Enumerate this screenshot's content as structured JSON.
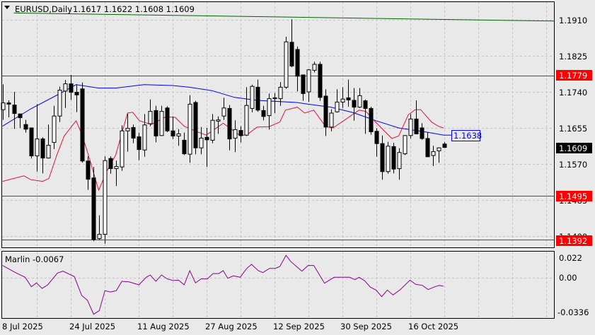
{
  "header": {
    "symbol_timeframe": "EURUSD,Daily",
    "ohlc_text": "1.1617 1.1622 1.1608 1.1609"
  },
  "indicator": {
    "label": "Marlin -0.0067",
    "axis_labels": [
      "0.022",
      "0.00",
      "-0.0336"
    ]
  },
  "price_axis": {
    "ticks": [
      "1.1910",
      "1.1825",
      "1.1740",
      "1.1655",
      "1.1570",
      "1.1485",
      "1.1400"
    ],
    "levels": [
      {
        "label": "1.1779",
        "value": 1.1779
      },
      {
        "label": "1.1495",
        "value": 1.1495
      },
      {
        "label": "1.1392",
        "value": 1.1392
      }
    ],
    "current_price_label": "1.1609",
    "ma_label": "1.1638"
  },
  "time_axis": {
    "labels": [
      "8 Jul 2025",
      "24 Jul 2025",
      "11 Aug 2025",
      "27 Aug 2025",
      "12 Sep 2025",
      "30 Sep 2025",
      "16 Oct 2025"
    ]
  },
  "colors": {
    "background": "#e9e9e9",
    "grid": "#c4c4c4",
    "level_line": "#ff0000",
    "level_label_bg": "#ff0000",
    "ma_blue": "#0000ff",
    "ma_red": "#e0143c",
    "trend_green": "#006400",
    "marlin": "#8b008b",
    "bull_body": "#ffffff",
    "bear_body": "#000000"
  },
  "chart_data": {
    "type": "candlestick",
    "title": "EURUSD,Daily",
    "ylim": [
      1.1365,
      1.196
    ],
    "price_grid": [
      1.191,
      1.1825,
      1.174,
      1.1655,
      1.157,
      1.1485,
      1.14
    ],
    "x_label_every_bars": 12,
    "ohlc": [
      [
        1.1698,
        1.1758,
        1.1674,
        1.1714
      ],
      [
        1.1714,
        1.172,
        1.168,
        1.1711
      ],
      [
        1.1709,
        1.174,
        1.1653,
        1.1689
      ],
      [
        1.1688,
        1.1688,
        1.1655,
        1.1679
      ],
      [
        1.1663,
        1.1674,
        1.1644,
        1.1652
      ],
      [
        1.1655,
        1.1655,
        1.1583,
        1.1589
      ],
      [
        1.1589,
        1.1711,
        1.1552,
        1.1629
      ],
      [
        1.1629,
        1.1633,
        1.1548,
        1.1584
      ],
      [
        1.1584,
        1.1663,
        1.1583,
        1.1614
      ],
      [
        1.1621,
        1.1707,
        1.1605,
        1.1683
      ],
      [
        1.1683,
        1.1752,
        1.1669,
        1.1744
      ],
      [
        1.1742,
        1.1768,
        1.1702,
        1.1759
      ],
      [
        1.1759,
        1.178,
        1.1721,
        1.1739
      ],
      [
        1.1739,
        1.1758,
        1.1692,
        1.1733
      ],
      [
        1.1747,
        1.1762,
        1.1573,
        1.1577
      ],
      [
        1.1577,
        1.1588,
        1.1509,
        1.1534
      ],
      [
        1.1537,
        1.1563,
        1.1388,
        1.1392
      ],
      [
        1.1394,
        1.1449,
        1.1391,
        1.1404
      ],
      [
        1.1404,
        1.1588,
        1.1382,
        1.1578
      ],
      [
        1.1583,
        1.1588,
        1.1547,
        1.1559
      ],
      [
        1.1559,
        1.1578,
        1.1518,
        1.1564
      ],
      [
        1.1563,
        1.1661,
        1.1554,
        1.1648
      ],
      [
        1.1648,
        1.1688,
        1.1599,
        1.1654
      ],
      [
        1.1656,
        1.1663,
        1.1619,
        1.1631
      ],
      [
        1.1634,
        1.1644,
        1.1579,
        1.1604
      ],
      [
        1.1603,
        1.1688,
        1.1587,
        1.1662
      ],
      [
        1.1665,
        1.1722,
        1.1659,
        1.1694
      ],
      [
        1.1696,
        1.1707,
        1.1621,
        1.1636
      ],
      [
        1.1637,
        1.1707,
        1.1636,
        1.1694
      ],
      [
        1.1702,
        1.1706,
        1.1645,
        1.1648
      ],
      [
        1.1648,
        1.1682,
        1.1629,
        1.1636
      ],
      [
        1.1636,
        1.1652,
        1.1613,
        1.1641
      ],
      [
        1.1626,
        1.1644,
        1.1591,
        1.1594
      ],
      [
        1.1593,
        1.1732,
        1.1573,
        1.1711
      ],
      [
        1.1715,
        1.1719,
        1.1593,
        1.1608
      ],
      [
        1.1608,
        1.1657,
        1.1593,
        1.1631
      ],
      [
        1.1633,
        1.1655,
        1.1563,
        1.1627
      ],
      [
        1.1626,
        1.1688,
        1.1619,
        1.1673
      ],
      [
        1.1671,
        1.1682,
        1.1641,
        1.1674
      ],
      [
        1.1683,
        1.1726,
        1.1674,
        1.1702
      ],
      [
        1.1701,
        1.1709,
        1.1602,
        1.1629
      ],
      [
        1.1631,
        1.1673,
        1.1598,
        1.1651
      ],
      [
        1.1649,
        1.1659,
        1.1621,
        1.1637
      ],
      [
        1.1638,
        1.1751,
        1.1636,
        1.1708
      ],
      [
        1.1701,
        1.1757,
        1.1692,
        1.1753
      ],
      [
        1.1751,
        1.1769,
        1.1693,
        1.1697
      ],
      [
        1.1696,
        1.1707,
        1.1673,
        1.1682
      ],
      [
        1.1684,
        1.1736,
        1.1651,
        1.1724
      ],
      [
        1.1724,
        1.1737,
        1.169,
        1.1726
      ],
      [
        1.1724,
        1.1763,
        1.1707,
        1.1751
      ],
      [
        1.1751,
        1.187,
        1.1747,
        1.1858
      ],
      [
        1.1857,
        1.1911,
        1.1798,
        1.1801
      ],
      [
        1.184,
        1.1847,
        1.1741,
        1.1777
      ],
      [
        1.178,
        1.178,
        1.1719,
        1.1736
      ],
      [
        1.174,
        1.1794,
        1.1716,
        1.1792
      ],
      [
        1.1791,
        1.1811,
        1.1786,
        1.1805
      ],
      [
        1.1805,
        1.1811,
        1.1719,
        1.1727
      ],
      [
        1.173,
        1.1746,
        1.1636,
        1.1657
      ],
      [
        1.1657,
        1.1699,
        1.1647,
        1.169
      ],
      [
        1.1693,
        1.1746,
        1.1691,
        1.1716
      ],
      [
        1.1716,
        1.1751,
        1.1702,
        1.1723
      ],
      [
        1.1726,
        1.1769,
        1.1705,
        1.1721
      ],
      [
        1.172,
        1.1749,
        1.1672,
        1.1704
      ],
      [
        1.1704,
        1.1749,
        1.1702,
        1.1731
      ],
      [
        1.1719,
        1.1722,
        1.1641,
        1.1701
      ],
      [
        1.1701,
        1.1705,
        1.1639,
        1.1646
      ],
      [
        1.1647,
        1.1654,
        1.1587,
        1.1618
      ],
      [
        1.1618,
        1.1637,
        1.1533,
        1.1552
      ],
      [
        1.1552,
        1.1622,
        1.1547,
        1.1612
      ],
      [
        1.1611,
        1.162,
        1.1548,
        1.1558
      ],
      [
        1.1559,
        1.1607,
        1.1533,
        1.1597
      ],
      [
        1.1594,
        1.1638,
        1.1591,
        1.1637
      ],
      [
        1.1637,
        1.1688,
        1.163,
        1.1676
      ],
      [
        1.1676,
        1.172,
        1.164,
        1.1641
      ],
      [
        1.1655,
        1.1666,
        1.1627,
        1.163
      ],
      [
        1.163,
        1.1645,
        1.1587,
        1.1587
      ],
      [
        1.159,
        1.1613,
        1.1565,
        1.1599
      ],
      [
        1.1601,
        1.1609,
        1.1573,
        1.1608
      ],
      [
        1.1617,
        1.1622,
        1.1608,
        1.1609
      ]
    ],
    "ma_blue": [
      [
        0,
        1.1659
      ],
      [
        5,
        1.17
      ],
      [
        10,
        1.1735
      ],
      [
        13,
        1.1757
      ],
      [
        17,
        1.1749
      ],
      [
        20,
        1.1749
      ],
      [
        25,
        1.1757
      ],
      [
        30,
        1.1755
      ],
      [
        33,
        1.1751
      ],
      [
        37,
        1.1743
      ],
      [
        41,
        1.1727
      ],
      [
        45,
        1.172
      ],
      [
        52,
        1.1715
      ],
      [
        54,
        1.1711
      ],
      [
        58,
        1.1704
      ],
      [
        62,
        1.1691
      ],
      [
        66,
        1.1672
      ],
      [
        70,
        1.1655
      ],
      [
        75,
        1.1645
      ],
      [
        78,
        1.1638
      ]
    ],
    "ma_red": [
      [
        0,
        1.1529
      ],
      [
        3.8,
        1.1542
      ],
      [
        5,
        1.1533
      ],
      [
        7.1,
        1.1529
      ],
      [
        8.2,
        1.1536
      ],
      [
        9.6,
        1.1591
      ],
      [
        10.9,
        1.1636
      ],
      [
        13,
        1.1672
      ],
      [
        14,
        1.1641
      ],
      [
        15,
        1.1599
      ],
      [
        17,
        1.1508
      ],
      [
        18.4,
        1.1552
      ],
      [
        20,
        1.1591
      ],
      [
        22.1,
        1.169
      ],
      [
        23,
        1.1692
      ],
      [
        24.2,
        1.1672
      ],
      [
        26.3,
        1.1663
      ],
      [
        28.8,
        1.1681
      ],
      [
        30.5,
        1.168
      ],
      [
        32.1,
        1.1659
      ],
      [
        34.2,
        1.1647
      ],
      [
        36,
        1.1638
      ],
      [
        39,
        1.1666
      ],
      [
        42.1,
        1.1636
      ],
      [
        43.4,
        1.1641
      ],
      [
        45,
        1.1657
      ],
      [
        47.1,
        1.1658
      ],
      [
        49,
        1.1669
      ],
      [
        50,
        1.1697
      ],
      [
        52.1,
        1.1704
      ],
      [
        53.4,
        1.169
      ],
      [
        55,
        1.1697
      ],
      [
        57.1,
        1.1658
      ],
      [
        58.4,
        1.1655
      ],
      [
        60.5,
        1.1674
      ],
      [
        63,
        1.1697
      ],
      [
        64.2,
        1.1694
      ],
      [
        65.9,
        1.1669
      ],
      [
        68.8,
        1.163
      ],
      [
        70,
        1.1636
      ],
      [
        71.7,
        1.1686
      ],
      [
        72.9,
        1.1698
      ],
      [
        73.9,
        1.1698
      ],
      [
        75.8,
        1.1669
      ],
      [
        77,
        1.1659
      ],
      [
        77.9,
        1.1655
      ]
    ],
    "trend_green": [
      [
        2,
        1.1926
      ],
      [
        97.5,
        1.1907
      ]
    ],
    "marlin": {
      "name": "Marlin",
      "last": -0.0067,
      "ylim": [
        -0.0336,
        0.022
      ],
      "points": [
        [
          0,
          0.0097
        ],
        [
          2.3,
          0.0041
        ],
        [
          4,
          0.0004
        ],
        [
          5.1,
          -0.0071
        ],
        [
          6,
          -0.0041
        ],
        [
          7,
          -0.0084
        ],
        [
          8,
          -0.0056
        ],
        [
          9.7,
          0.0037
        ],
        [
          10.7,
          0.0052
        ],
        [
          12.7,
          0.0009
        ],
        [
          14,
          -0.014
        ],
        [
          15,
          -0.0177
        ],
        [
          16.1,
          -0.0288
        ],
        [
          17.1,
          -0.026
        ],
        [
          18.1,
          -0.0102
        ],
        [
          19.1,
          -0.0112
        ],
        [
          20.1,
          -0.0102
        ],
        [
          21.1,
          -0.0028
        ],
        [
          22.4,
          -0.0033
        ],
        [
          24.1,
          -0.0056
        ],
        [
          25.4,
          0.0004
        ],
        [
          26.1,
          0.0022
        ],
        [
          27.1,
          -0.0028
        ],
        [
          28.1,
          0.0022
        ],
        [
          29.1,
          -0.0009
        ],
        [
          30.1,
          -0.0022
        ],
        [
          31.1,
          -0.0019
        ],
        [
          32.1,
          -0.0056
        ],
        [
          33.1,
          0.0056
        ],
        [
          34.1,
          -0.0041
        ],
        [
          35.1,
          -0.0009
        ],
        [
          36.2,
          -0.0009
        ],
        [
          37.2,
          0.0033
        ],
        [
          38.2,
          0.0033
        ],
        [
          39,
          0.0056
        ],
        [
          39.8,
          -0.0004
        ],
        [
          40.8,
          0.0015
        ],
        [
          42,
          0.0004
        ],
        [
          43.1,
          0.0071
        ],
        [
          44,
          0.0106
        ],
        [
          45.2,
          0.0056
        ],
        [
          46,
          0.0041
        ],
        [
          47.2,
          0.0074
        ],
        [
          48.2,
          0.0074
        ],
        [
          49,
          0.0089
        ],
        [
          50.1,
          0.0177
        ],
        [
          50.9,
          0.013
        ],
        [
          52.9,
          0.0052
        ],
        [
          54,
          0.0097
        ],
        [
          55,
          0.0097
        ],
        [
          56.9,
          -0.0043
        ],
        [
          58.6,
          0.0004
        ],
        [
          61.3,
          0.0004
        ],
        [
          62.3,
          -0.0015
        ],
        [
          63,
          0.0004
        ],
        [
          64,
          -0.0024
        ],
        [
          65,
          -0.0074
        ],
        [
          66,
          -0.0097
        ],
        [
          67,
          -0.0149
        ],
        [
          68,
          -0.0097
        ],
        [
          69,
          -0.0136
        ],
        [
          70.3,
          -0.0093
        ],
        [
          72,
          -0.0019
        ],
        [
          73,
          -0.0052
        ],
        [
          74.2,
          -0.006
        ],
        [
          75.2,
          -0.0093
        ],
        [
          76.4,
          -0.0071
        ],
        [
          77.2,
          -0.006
        ],
        [
          77.9,
          -0.0067
        ]
      ]
    }
  }
}
